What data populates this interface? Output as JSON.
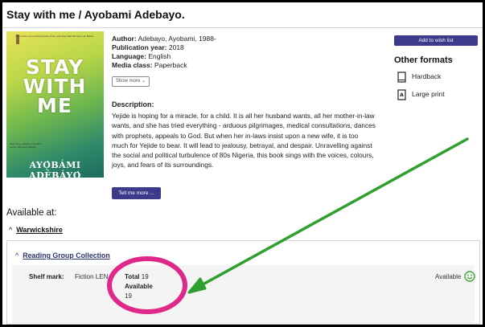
{
  "book": {
    "title": "Stay with me / Ayobami Adebayo.",
    "cover": {
      "blurb": "One of the most exciting books of the year Stay With Me has it all. Bellow",
      "words": [
        "STAY",
        "WITH",
        "ME"
      ],
      "quote": "Searching, gripping, intimately tender. Margaret Atwood",
      "author": "AYỌ̀BÁMI ADÉBÁYỌ̀"
    },
    "meta": [
      {
        "label": "Author:",
        "value": "Adebayo, Ayobami, 1988-"
      },
      {
        "label": "Publication year:",
        "value": "2018"
      },
      {
        "label": "Language:",
        "value": "English"
      },
      {
        "label": "Media class:",
        "value": "Paperback"
      }
    ],
    "show_more": "Show more ⌄",
    "description_heading": "Description:",
    "description": "Yejide is hoping for a miracle, for a child. It is all her husband wants, all her mother-in-law wants, and she has tried everything - arduous pilgrimages, medical consultations, dances with prophets, appeals to God. But when her in-laws insist upon a new wife, it is too much for Yejide to bear. It will lead to jealousy, betrayal, and despair. Unravelling against the social and political turbulence of 80s Nigeria, this book sings with the voices, colours, joys, and fears of its surroundings.",
    "tell_more": "Tell me more ..."
  },
  "sidebar": {
    "wish_button": "Add to wish list",
    "other_formats_heading": "Other formats",
    "formats": [
      {
        "label": "Hardback",
        "icon": "book-icon"
      },
      {
        "label": "Large print",
        "icon": "large-print-icon"
      }
    ]
  },
  "availability": {
    "heading": "Available at:",
    "region": "Warwickshire",
    "collection": "Reading Group Collection",
    "shelf_label": "Shelf mark:",
    "shelf_value": "Fiction LEN",
    "total_label": "Total",
    "total_value": "19",
    "available_label": "Available",
    "available_value": "19",
    "status": "Available",
    "status_icon": "smiley-icon"
  },
  "annotation": {
    "arrow_color": "#2fa02f",
    "circle_color": "#e0278a"
  }
}
